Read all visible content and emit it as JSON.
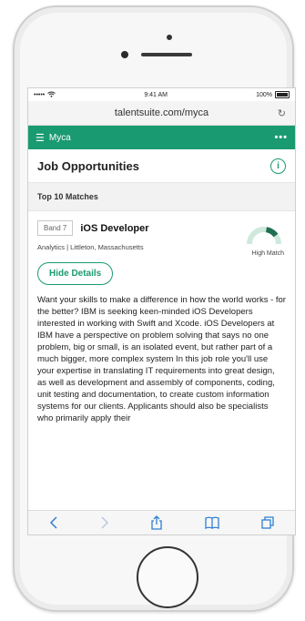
{
  "status": {
    "signal": "••••• ",
    "time": "9:41 AM",
    "battery": "100%"
  },
  "browser": {
    "url": "talentsuite.com/myca",
    "reload_icon": "reload-icon"
  },
  "app": {
    "name": "Myca",
    "menu_icon": "menu-icon",
    "more_label": "•••"
  },
  "page": {
    "title": "Job Opportunities",
    "info_icon": "info-icon"
  },
  "section": {
    "title": "Top 10 Matches"
  },
  "job": {
    "band": "Band 7",
    "title": "iOS Developer",
    "meta": "Analytics | Littleton, Massachusetts",
    "match_label": "High Match",
    "match_level": 0.8
  },
  "buttons": {
    "hide_details": "Hide Details"
  },
  "description": "Want your skills to make a difference in how the world works - for the better? IBM is seeking keen-minded iOS Developers interested in working with Swift and Xcode. iOS Developers at IBM have a perspective on problem solving that says no one problem, big or small, is an isolated event, but rather part of a much bigger, more complex system In this job role you'll use your expertise in translating IT requirements into great design, as well as development and assembly of components, coding, unit testing and documentation, to create custom information systems for our clients. Applicants should also be specialists who primarily apply their",
  "colors": {
    "accent": "#1a9a70",
    "gauge_light": "#cfe9dd",
    "gauge_dark": "#1f6f52"
  }
}
